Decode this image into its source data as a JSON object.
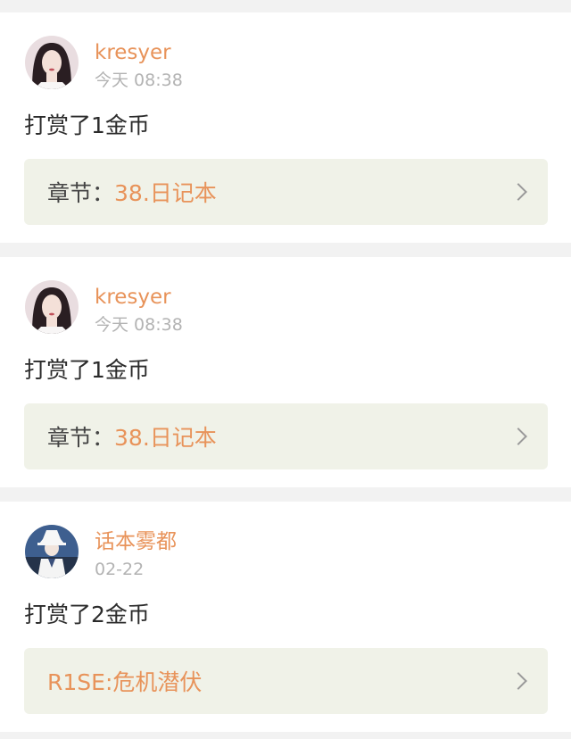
{
  "feed": {
    "items": [
      {
        "avatar": "avatar-girl-dark-hair",
        "username": "kresyer",
        "time": "今天 08:38",
        "action": "打赏了1金币",
        "target_prefix": "章节：",
        "target_title": "38.日记本"
      },
      {
        "avatar": "avatar-girl-dark-hair",
        "username": "kresyer",
        "time": "今天 08:38",
        "action": "打赏了1金币",
        "target_prefix": "章节：",
        "target_title": "38.日记本"
      },
      {
        "avatar": "avatar-figure-white-hat",
        "username": "话本雾都",
        "time": "02-22",
        "action": "打赏了2金币",
        "target_prefix": "",
        "target_title": "R1SE:危机潜伏"
      }
    ]
  },
  "colors": {
    "accent": "#e8935a",
    "muted": "#b3b3b3",
    "target_bg": "#f0f2e8",
    "separator_bg": "#f2f2f2"
  }
}
